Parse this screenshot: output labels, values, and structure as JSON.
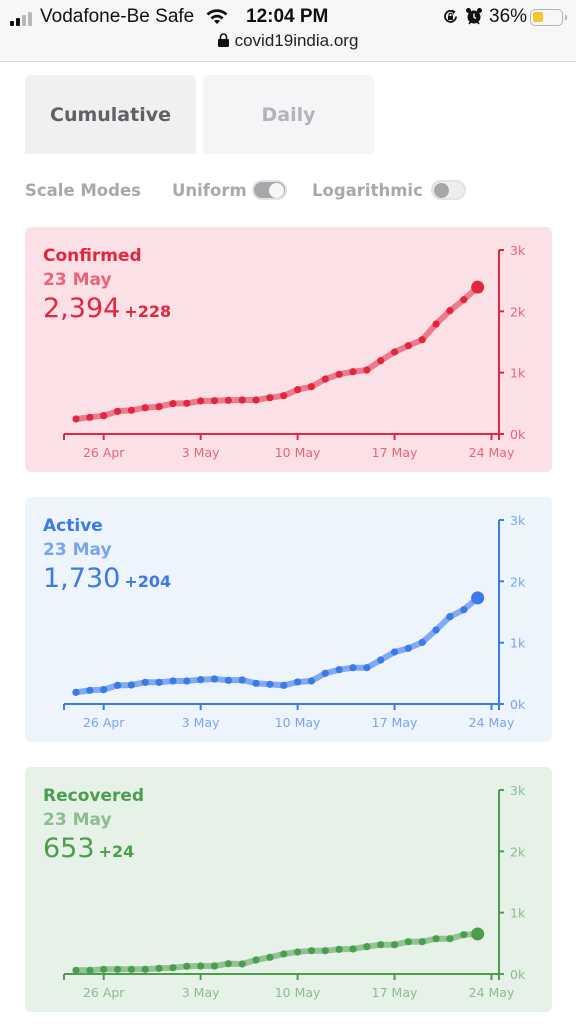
{
  "status_bar": {
    "carrier": "Vodafone-Be Safe",
    "time": "12:04 PM",
    "battery_percent": "36%",
    "battery_level": 0.36,
    "icons": [
      "signal-icon",
      "wifi-icon",
      "rotation-lock-icon",
      "alarm-icon",
      "battery-icon"
    ]
  },
  "browser": {
    "url": "covid19india.org",
    "lock_icon": "lock-icon"
  },
  "tabs": [
    {
      "label": "Cumulative",
      "active": true
    },
    {
      "label": "Daily",
      "active": false
    }
  ],
  "scale_modes": {
    "label": "Scale Modes",
    "uniform": {
      "label": "Uniform",
      "on": true
    },
    "logarithmic": {
      "label": "Logarithmic",
      "on": false
    }
  },
  "cards": [
    {
      "title": "Confirmed",
      "date": "23 May",
      "value": "2,394",
      "delta": "+228",
      "colors": {
        "bg": "#fbe1e6",
        "main": "#e3263f",
        "light": "#e8647a",
        "line": "#e7697e"
      }
    },
    {
      "title": "Active",
      "date": "23 May",
      "value": "1,730",
      "delta": "+204",
      "colors": {
        "bg": "#eef4fc",
        "main": "#3b7ae8",
        "light": "#7aa5ee",
        "line": "#6c9cf0"
      }
    },
    {
      "title": "Recovered",
      "date": "23 May",
      "value": "653",
      "delta": "+24",
      "colors": {
        "bg": "#e6f1e7",
        "main": "#4b9e4f",
        "light": "#8cbd8e",
        "line": "#84bb86"
      }
    }
  ],
  "chart_data": [
    {
      "type": "line",
      "title": "Confirmed",
      "xlabel": "",
      "ylabel": "",
      "x_start": "24 Apr",
      "x_end": "23 May",
      "x_ticks": [
        "26 Apr",
        "3 May",
        "10 May",
        "17 May",
        "24 May"
      ],
      "x_tick_day_index": [
        2,
        9,
        16,
        23,
        30
      ],
      "y_ticks": [
        "0k",
        "1k",
        "2k",
        "3k"
      ],
      "ylim": [
        0,
        3000
      ],
      "grid": false,
      "y_axis_position": "right",
      "values": [
        245,
        272,
        299,
        370,
        386,
        429,
        446,
        495,
        500,
        538,
        543,
        549,
        554,
        554,
        592,
        625,
        723,
        772,
        897,
        973,
        1016,
        1043,
        1196,
        1337,
        1440,
        1538,
        1793,
        2011,
        2190,
        2394
      ]
    },
    {
      "type": "line",
      "title": "Active",
      "xlabel": "",
      "ylabel": "",
      "x_start": "24 Apr",
      "x_end": "23 May",
      "x_ticks": [
        "26 Apr",
        "3 May",
        "10 May",
        "17 May",
        "24 May"
      ],
      "x_tick_day_index": [
        2,
        9,
        16,
        23,
        30
      ],
      "y_ticks": [
        "0k",
        "1k",
        "2k",
        "3k"
      ],
      "ylim": [
        0,
        3000
      ],
      "grid": false,
      "y_axis_position": "right",
      "values": [
        190,
        223,
        234,
        304,
        310,
        353,
        353,
        375,
        375,
        397,
        408,
        386,
        391,
        337,
        321,
        304,
        359,
        375,
        500,
        560,
        592,
        592,
        717,
        848,
        908,
        1005,
        1207,
        1424,
        1538,
        1730
      ]
    },
    {
      "type": "line",
      "title": "Recovered",
      "xlabel": "",
      "ylabel": "",
      "x_start": "24 Apr",
      "x_end": "23 May",
      "x_ticks": [
        "26 Apr",
        "3 May",
        "10 May",
        "17 May",
        "24 May"
      ],
      "x_tick_day_index": [
        2,
        9,
        16,
        23,
        30
      ],
      "y_ticks": [
        "0k",
        "1k",
        "2k",
        "3k"
      ],
      "ylim": [
        0,
        3000
      ],
      "grid": false,
      "y_axis_position": "right",
      "values": [
        60,
        60,
        76,
        76,
        76,
        76,
        92,
        103,
        125,
        130,
        130,
        168,
        163,
        228,
        272,
        326,
        359,
        380,
        380,
        402,
        408,
        446,
        478,
        478,
        527,
        527,
        576,
        576,
        641,
        653
      ]
    }
  ]
}
